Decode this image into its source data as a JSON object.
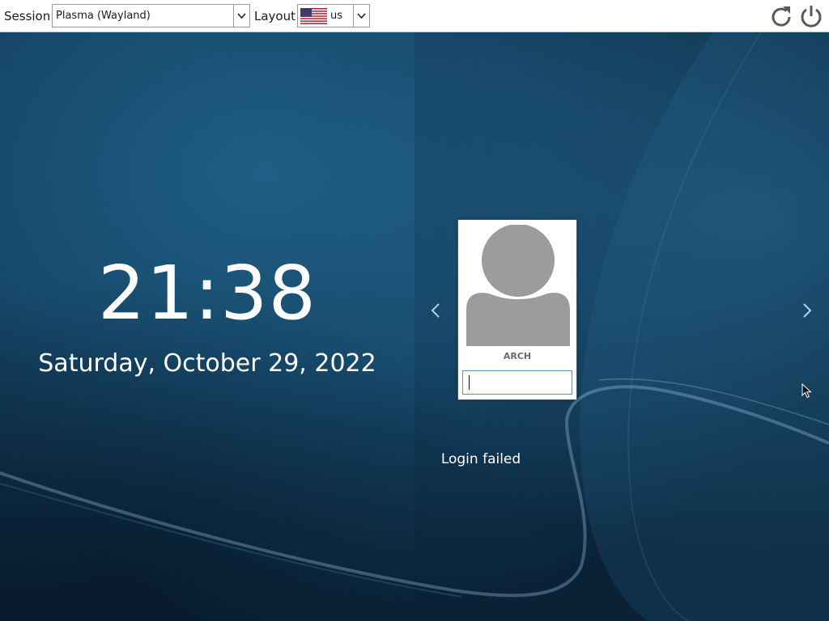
{
  "topbar": {
    "session_label": "Session",
    "session_value": "Plasma (Wayland)",
    "layout_label": "Layout",
    "layout_value": "us",
    "layout_flag": "us-flag-icon"
  },
  "clock": {
    "time": "21:38",
    "date": "Saturday, October 29, 2022"
  },
  "user_card": {
    "username": "ARCH",
    "password_value": ""
  },
  "status": {
    "message": "Login failed"
  },
  "icons": {
    "reboot": "reboot-icon",
    "shutdown": "power-icon",
    "prev": "chevron-left-icon",
    "next": "chevron-right-icon",
    "dropdown": "chevron-down-icon"
  },
  "colors": {
    "background": "#0d2b44",
    "accent": "#1d5f85",
    "avatar_gray": "#9c9c9c",
    "text_light": "#ffffff"
  }
}
